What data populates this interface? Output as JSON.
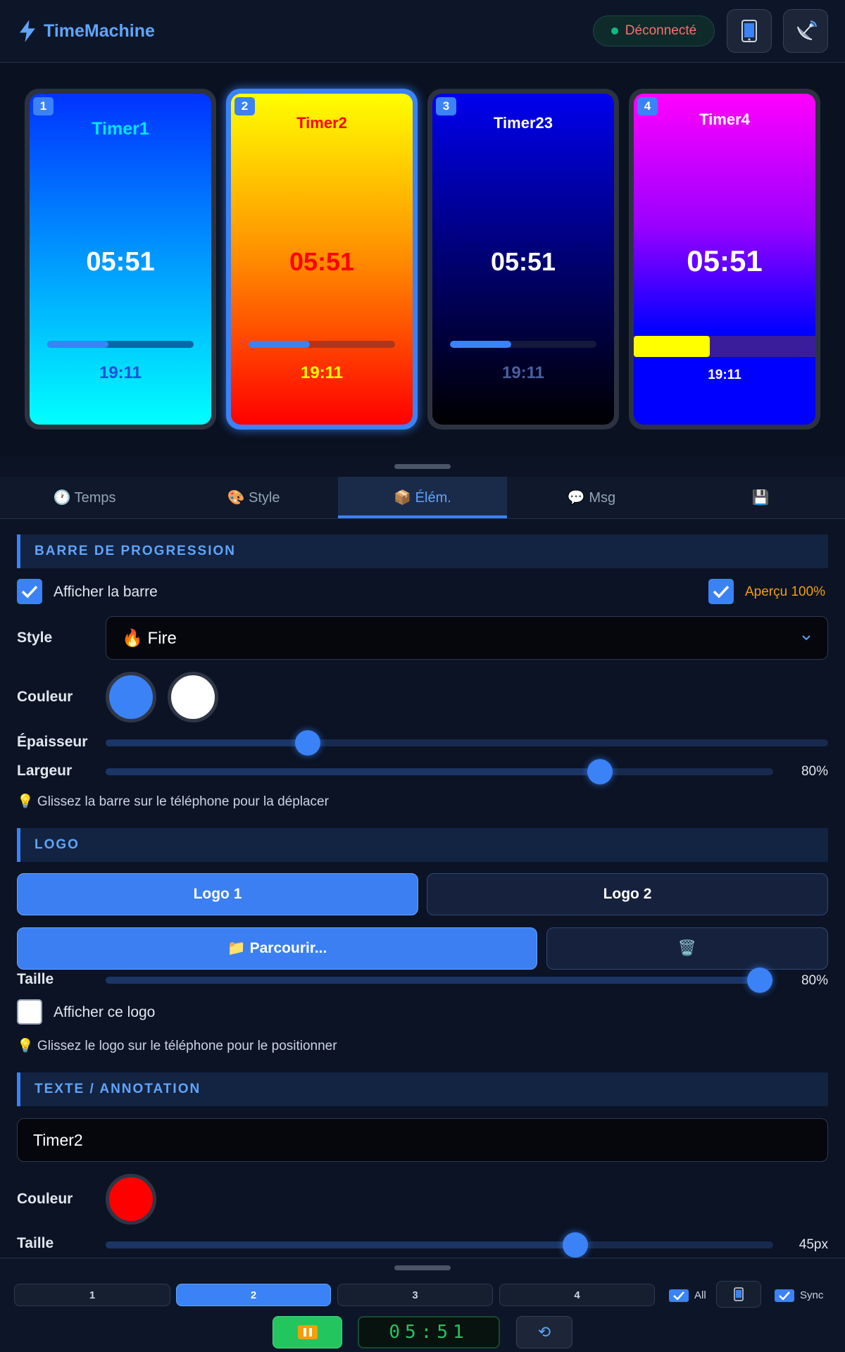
{
  "app": {
    "name": "TimeMachine",
    "status": "Déconnecté"
  },
  "phones": [
    {
      "num": "1",
      "title": "Timer1",
      "time": "05:51",
      "end": "19:11",
      "progress": 0.42
    },
    {
      "num": "2",
      "title": "Timer2",
      "time": "05:51",
      "end": "19:11",
      "progress": 0.42
    },
    {
      "num": "3",
      "title": "Timer23",
      "time": "05:51",
      "end": "19:11",
      "progress": 0.42
    },
    {
      "num": "4",
      "title": "Timer4",
      "time": "05:51",
      "end": "19:11",
      "progress": 0.42
    }
  ],
  "tabs": [
    {
      "label": "🕐 Temps"
    },
    {
      "label": "🎨 Style"
    },
    {
      "label": "📦 Élém."
    },
    {
      "label": "💬 Msg"
    },
    {
      "label": "💾"
    }
  ],
  "progress_section": {
    "title": "BARRE DE PROGRESSION",
    "show_label": "Afficher la barre",
    "preview_label": "Aperçu 100%",
    "style_label": "Style",
    "style_value": "🔥 Fire",
    "color_label": "Couleur",
    "colors": [
      "#3b82f6",
      "#ffffff"
    ],
    "thickness_label": "Épaisseur",
    "thickness_value": 0.28,
    "width_label": "Largeur",
    "width_value": 0.74,
    "width_text": "80%",
    "hint": "💡 Glissez la barre sur le téléphone pour la déplacer"
  },
  "logo_section": {
    "title": "LOGO",
    "logo1": "Logo 1",
    "logo2": "Logo 2",
    "browse": "📁 Parcourir...",
    "delete": "🗑️",
    "size_label": "Taille",
    "size_value": 0.98,
    "size_text": "80%",
    "show_label": "Afficher ce logo",
    "hint": "💡 Glissez le logo sur le téléphone pour le positionner"
  },
  "text_section": {
    "title": "TEXTE / ANNOTATION",
    "value": "Timer2",
    "color_label": "Couleur",
    "color": "#ff0000",
    "size_label": "Taille",
    "size_value": 0.704,
    "size_text": "45px"
  },
  "bottom": {
    "selectors": [
      "1",
      "2",
      "3",
      "4"
    ],
    "all_label": "All",
    "sync_label": "Sync",
    "time": "05:51",
    "reset_icon": "⟲"
  }
}
